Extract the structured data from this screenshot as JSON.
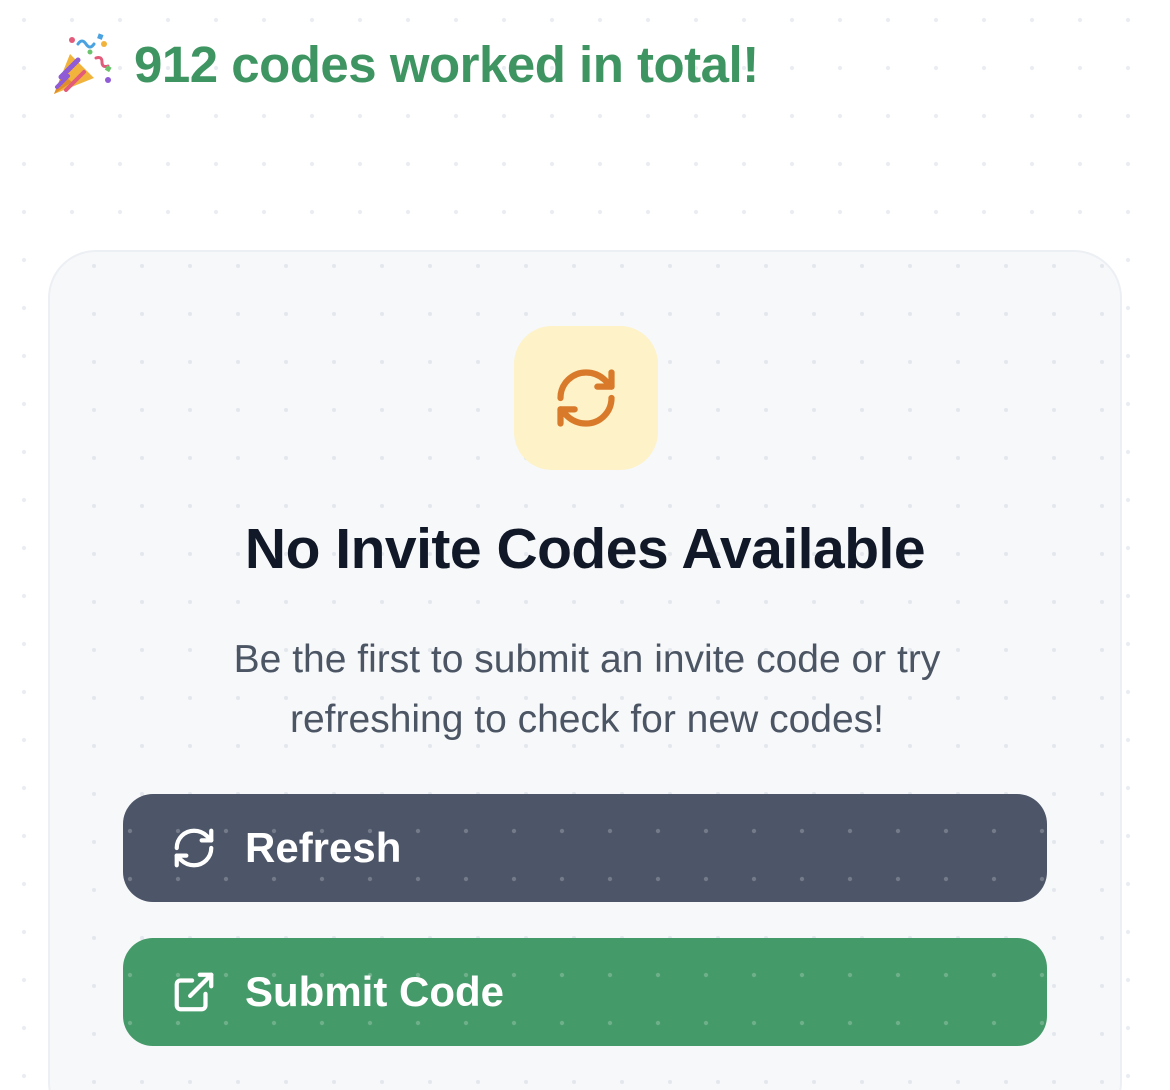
{
  "stats": {
    "icon": "party-popper-icon",
    "text": "912 codes worked in total!",
    "color": "#3f9562"
  },
  "empty_state": {
    "icon": "refresh-icon",
    "icon_color": "#d97a2b",
    "icon_bg": "#fdf2c8",
    "title": "No Invite Codes Available",
    "description": "Be the first to submit an invite code or try refreshing to check for new codes!"
  },
  "actions": {
    "refresh": {
      "label": "Refresh",
      "icon": "refresh-icon",
      "color": "#4d5668"
    },
    "submit": {
      "label": "Submit Code",
      "icon": "external-link-icon",
      "color": "#459a69"
    }
  }
}
